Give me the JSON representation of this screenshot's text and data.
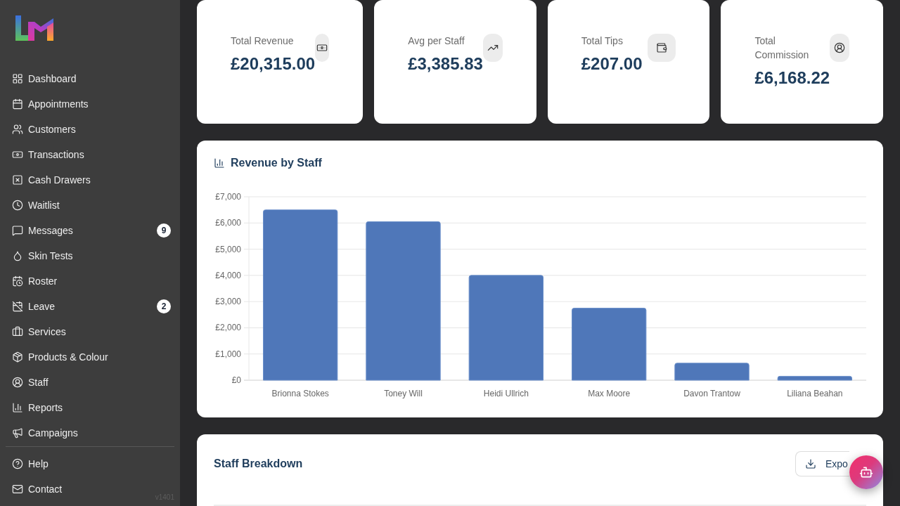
{
  "sidebar": {
    "nav_items": [
      {
        "label": "Dashboard",
        "selected": false
      },
      {
        "label": "Appointments",
        "selected": false
      },
      {
        "label": "Customers",
        "selected": false
      },
      {
        "label": "Transactions",
        "selected": false
      },
      {
        "label": "Cash Drawers",
        "selected": false
      },
      {
        "label": "Waitlist",
        "selected": false
      },
      {
        "label": "Messages",
        "badge": "9",
        "selected": false
      },
      {
        "label": "Skin Tests",
        "selected": false
      },
      {
        "label": "Roster",
        "selected": false
      },
      {
        "label": "Leave",
        "badge": "2",
        "selected": false
      },
      {
        "label": "Services",
        "selected": false
      },
      {
        "label": "Products & Colour",
        "selected": false
      },
      {
        "label": "Staff",
        "selected": false
      },
      {
        "label": "Reports",
        "selected": false
      },
      {
        "label": "Campaigns",
        "selected": false
      }
    ],
    "footer_items": [
      {
        "label": "Help",
        "selected": false
      },
      {
        "label": "Contact",
        "selected": false
      }
    ],
    "version": "v1401"
  },
  "stats": [
    {
      "label": "Total Revenue",
      "value": "£20,315.00"
    },
    {
      "label": "Avg per Staff",
      "value": "£3,385.83"
    },
    {
      "label": "Total Tips",
      "value": "£207.00"
    },
    {
      "label": "Total Commission",
      "value": "£6,168.22"
    }
  ],
  "revenue_chart": {
    "title": "Revenue by Staff",
    "chart_data": {
      "type": "bar",
      "categories": [
        "Brionna Stokes",
        "Toney Will",
        "Heidi Ullrich",
        "Max Moore",
        "Davon Trantow",
        "Liliana Beahan"
      ],
      "values": [
        6500,
        6050,
        4000,
        2750,
        650,
        150
      ],
      "ylim": [
        0,
        7000
      ],
      "yticks": [
        {
          "value": 0,
          "label": "£0"
        },
        {
          "value": 1000,
          "label": "£1,000"
        },
        {
          "value": 2000,
          "label": "£2,000"
        },
        {
          "value": 3000,
          "label": "£3,000"
        },
        {
          "value": 4000,
          "label": "£4,000"
        },
        {
          "value": 5000,
          "label": "£5,000"
        },
        {
          "value": 6000,
          "label": "£6,000"
        },
        {
          "value": 7000,
          "label": "£7,000"
        }
      ],
      "grid": true
    }
  },
  "staff_breakdown": {
    "title": "Staff Breakdown",
    "export_button": "Expo"
  }
}
